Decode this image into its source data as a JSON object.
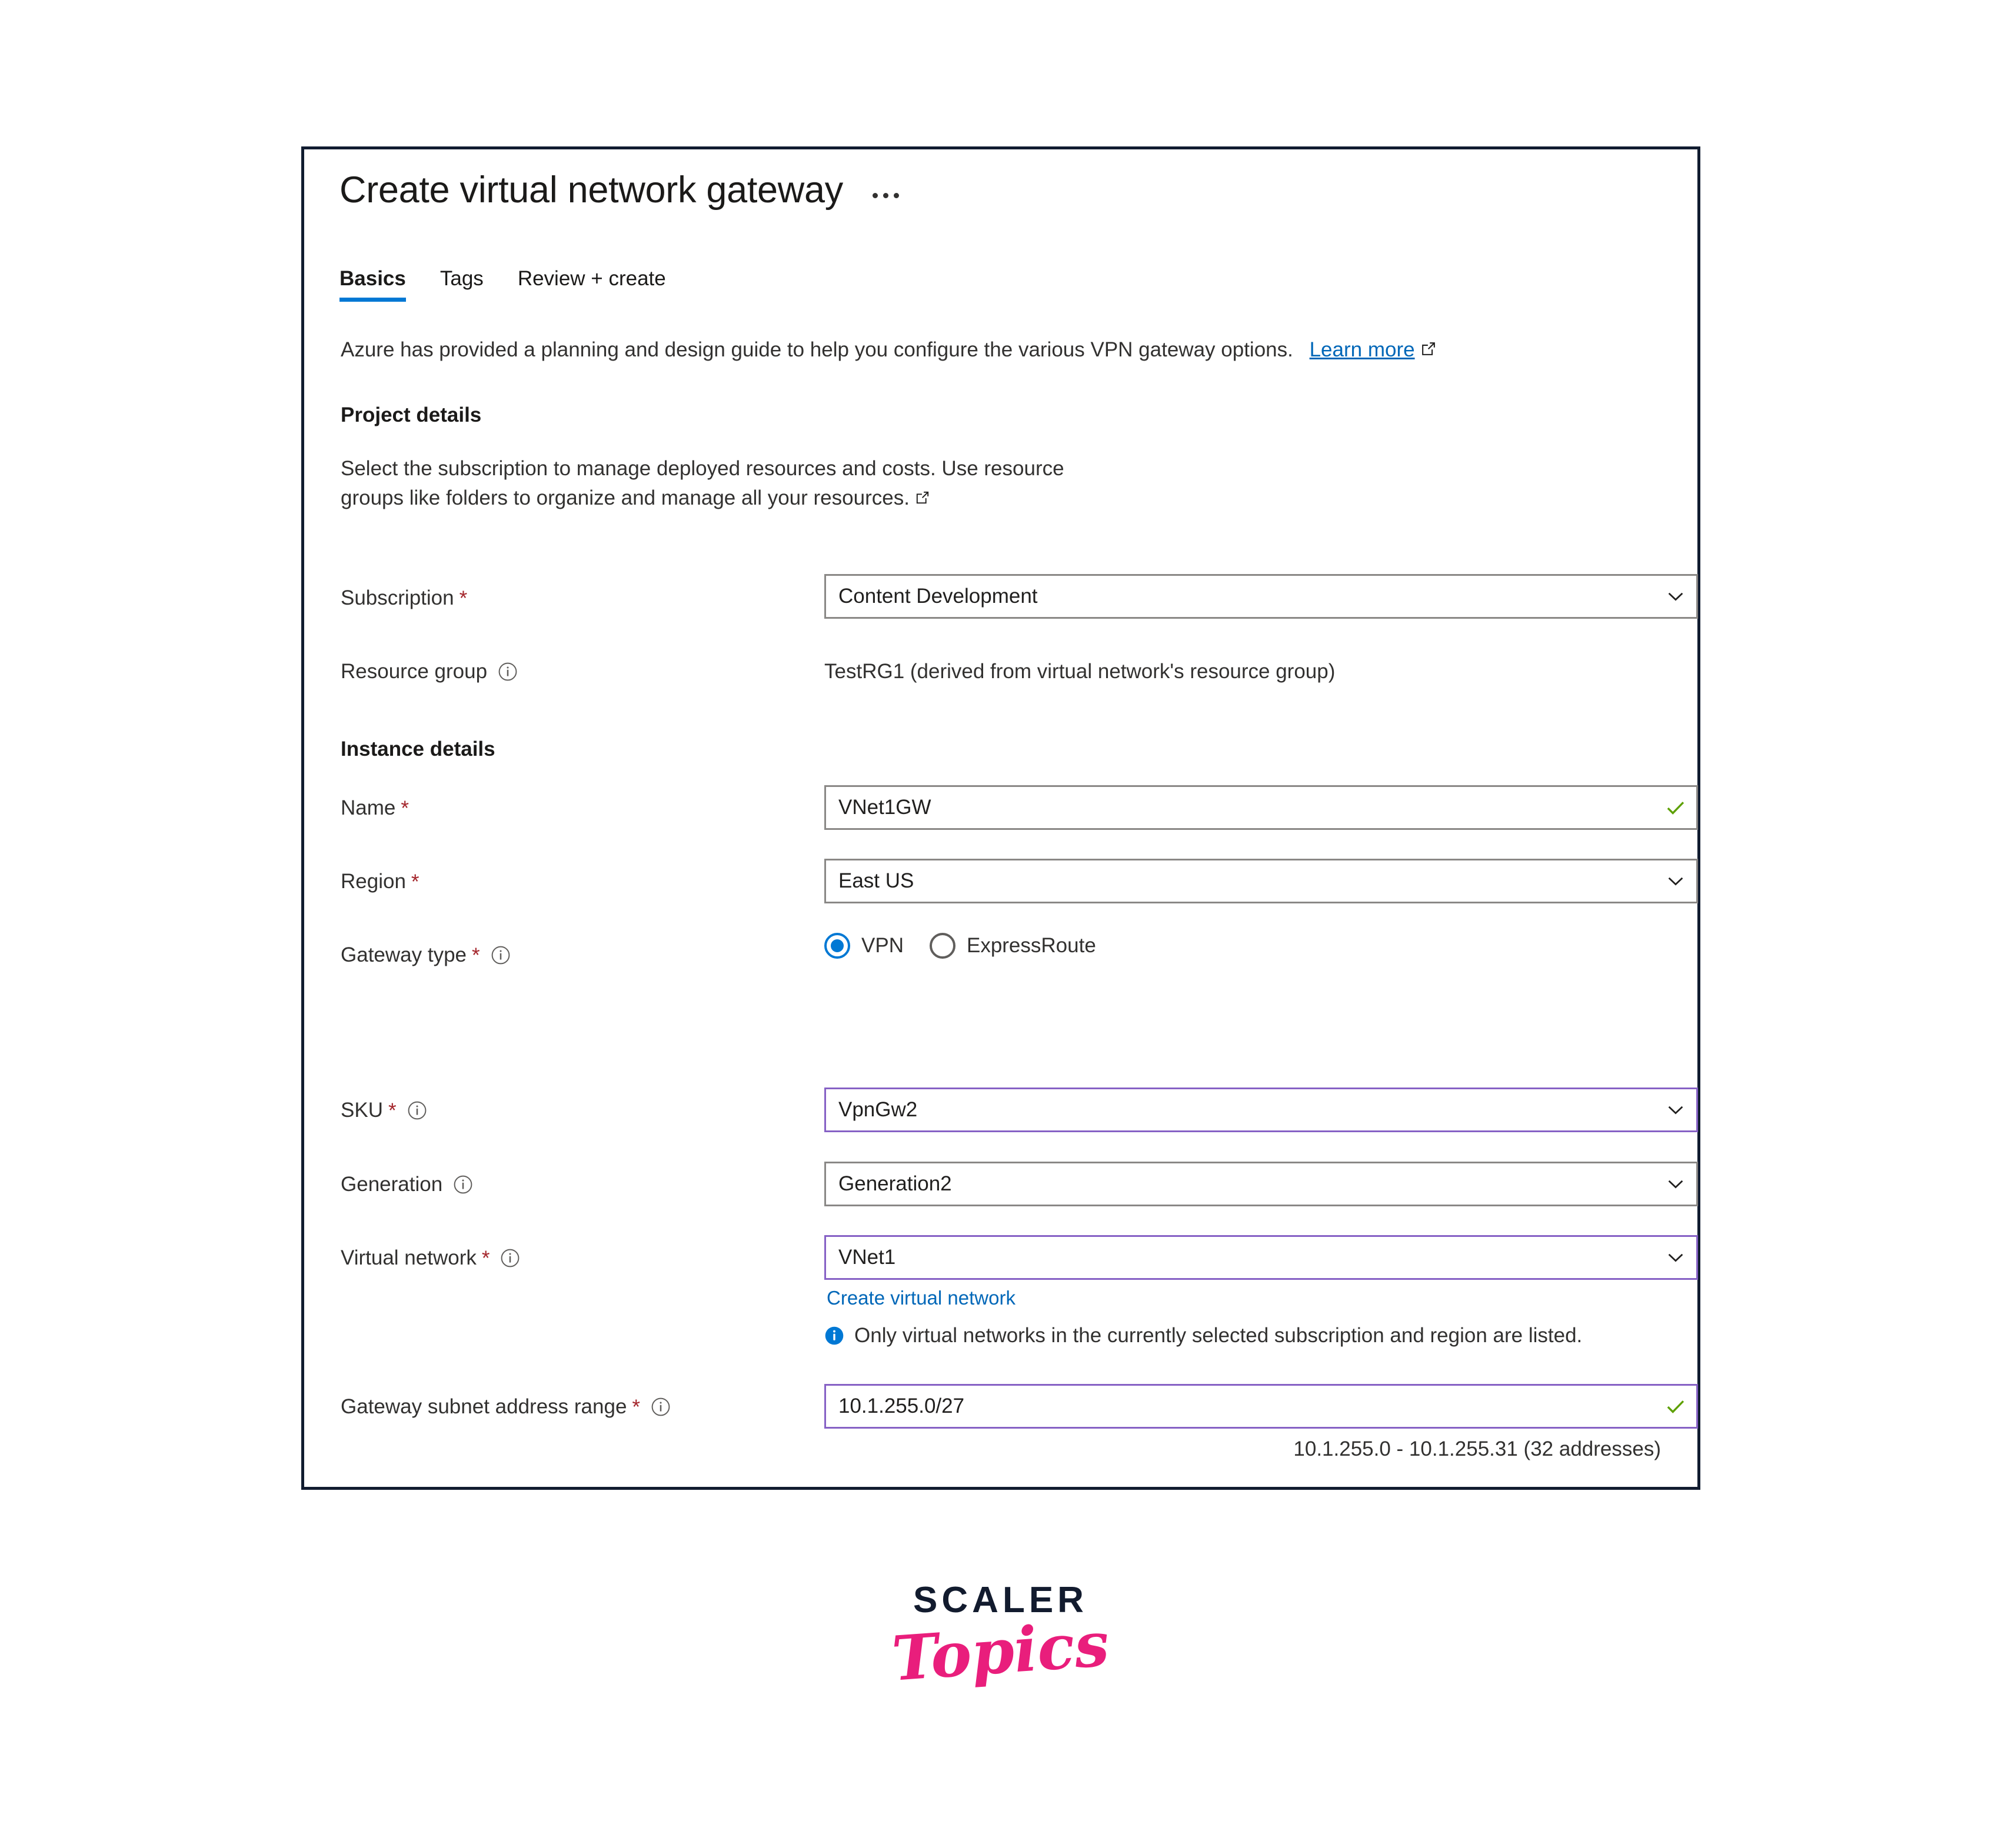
{
  "blade": {
    "title": "Create virtual network gateway",
    "overflow_menu": "…",
    "tabs": [
      {
        "label": "Basics",
        "active": true
      },
      {
        "label": "Tags",
        "active": false
      },
      {
        "label": "Review + create",
        "active": false
      }
    ],
    "intro": {
      "text": "Azure has provided a planning and design guide to help you configure the various VPN gateway options.",
      "link_label": "Learn more"
    },
    "project_details": {
      "heading": "Project details",
      "description": "Select the subscription to manage deployed resources and costs. Use resource groups like folders to organize and manage all your resources.",
      "subscription": {
        "label": "Subscription",
        "required": "*",
        "value": "Content Development"
      },
      "resource_group": {
        "label": "Resource group",
        "value": "TestRG1 (derived from virtual network's resource group)"
      }
    },
    "instance_details": {
      "heading": "Instance details",
      "name": {
        "label": "Name",
        "required": "*",
        "value": "VNet1GW"
      },
      "region": {
        "label": "Region",
        "required": "*",
        "value": "East US"
      },
      "gateway_type": {
        "label": "Gateway type",
        "required": "*",
        "options": [
          {
            "label": "VPN",
            "checked": true
          },
          {
            "label": "ExpressRoute",
            "checked": false
          }
        ]
      },
      "sku": {
        "label": "SKU",
        "required": "*",
        "value": "VpnGw2"
      },
      "generation": {
        "label": "Generation",
        "value": "Generation2"
      },
      "virtual_network": {
        "label": "Virtual network",
        "required": "*",
        "value": "VNet1",
        "create_link": "Create virtual network",
        "info_message": "Only virtual networks in the currently selected subscription and region are listed."
      },
      "gateway_subnet": {
        "label": "Gateway subnet address range",
        "required": "*",
        "value": "10.1.255.0/27",
        "helper": "10.1.255.0 - 10.1.255.31 (32 addresses)"
      }
    }
  },
  "watermark": {
    "brand": "SCALER",
    "sub_brand": "Topics"
  },
  "colors": {
    "accent_blue": "#0078d4",
    "link_blue": "#0067b8",
    "required_red": "#a4262c",
    "modified_purple": "#8661c5",
    "valid_green": "#5da000",
    "border_gray": "#8a8886",
    "card_border": "#111c30",
    "brand_navy": "#121b2e",
    "brand_pink": "#e91e7c"
  }
}
